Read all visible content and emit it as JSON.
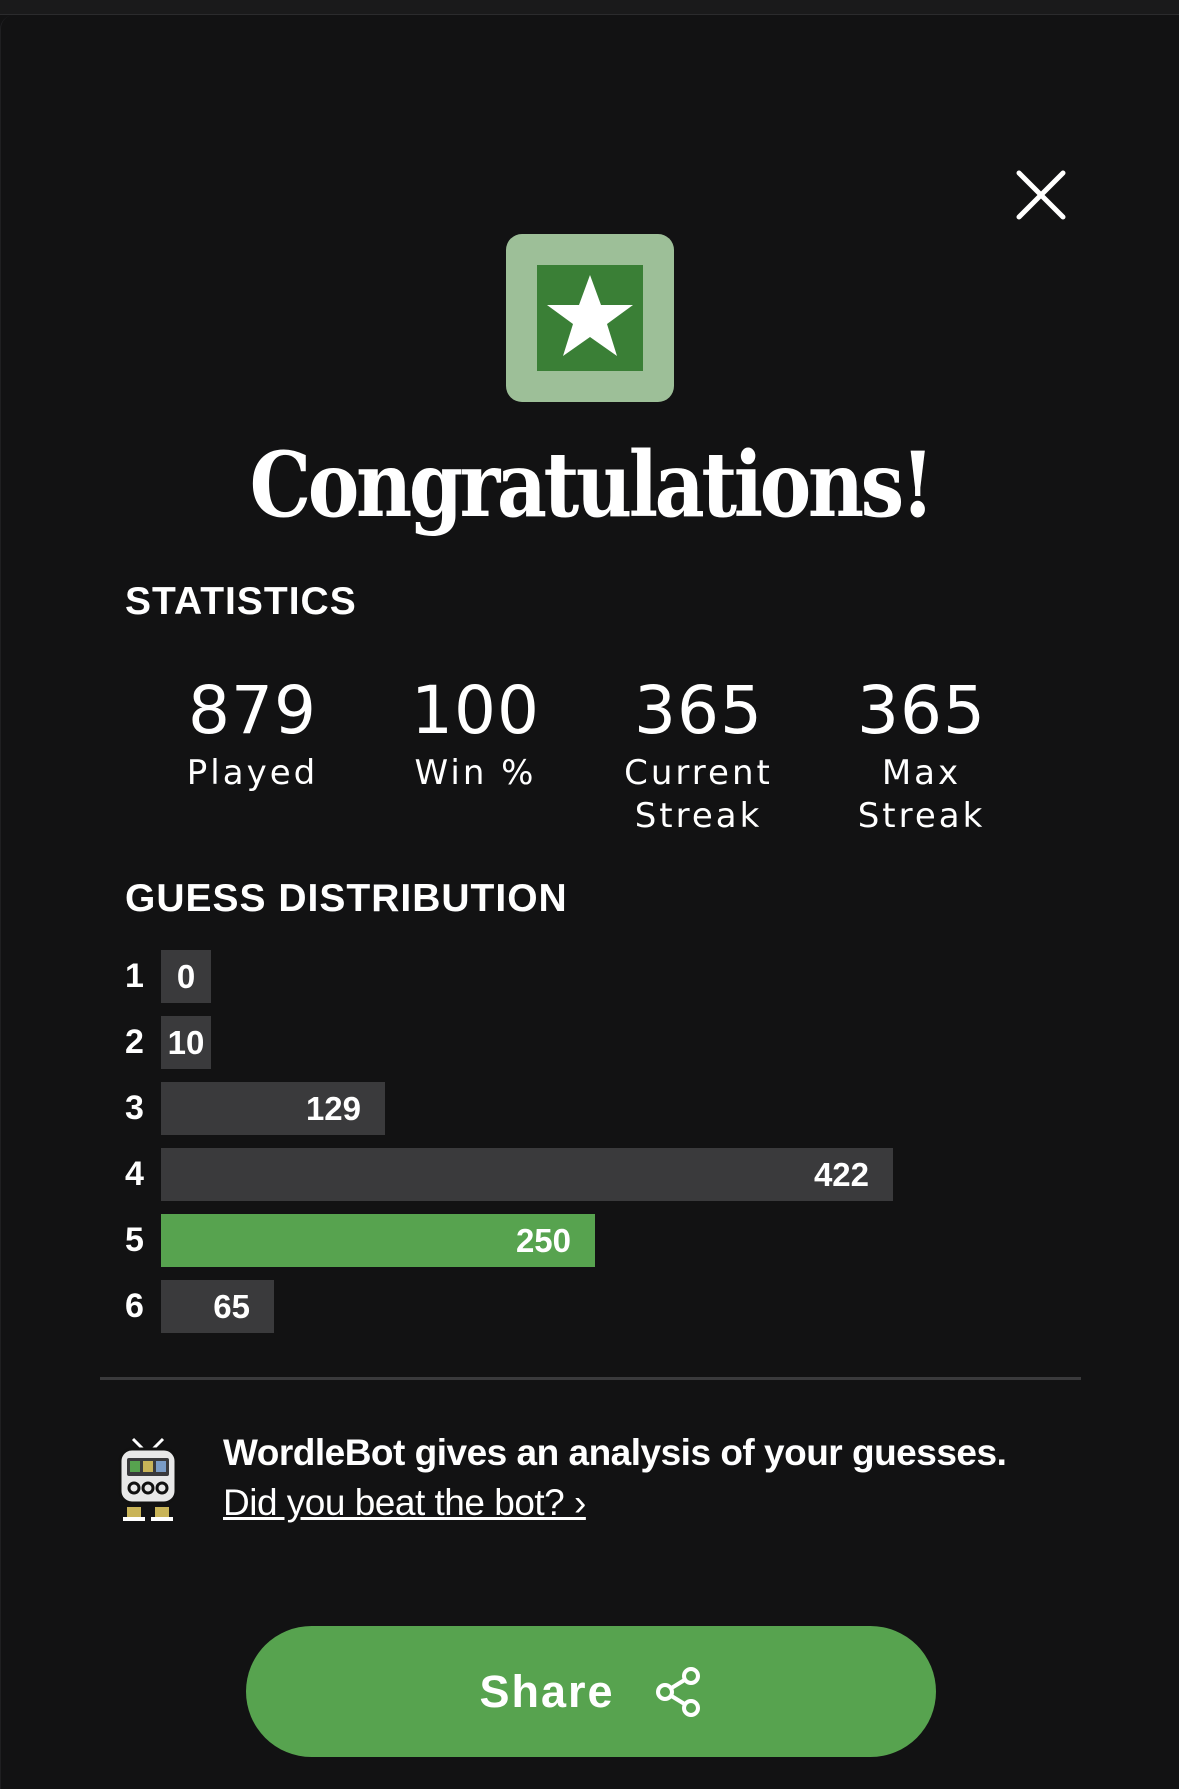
{
  "modal": {
    "title": "Congratulations!",
    "close_icon": "close-icon",
    "badge_icon": "star-icon",
    "colors": {
      "background": "#121213",
      "correct": "#57a34f",
      "bar": "#3a3a3c",
      "badge_outer": "#9dbf98",
      "badge_inner": "#3a7f36"
    }
  },
  "statistics": {
    "heading": "STATISTICS",
    "items": [
      {
        "value": "879",
        "label_lines": [
          "Played"
        ]
      },
      {
        "value": "100",
        "label_lines": [
          "Win %"
        ]
      },
      {
        "value": "365",
        "label_lines": [
          "Current",
          "Streak"
        ]
      },
      {
        "value": "365",
        "label_lines": [
          "Max",
          "Streak"
        ]
      }
    ]
  },
  "guess_distribution": {
    "heading": "GUESS DISTRIBUTION",
    "max_value": 422,
    "highlight_row": 5,
    "rows": [
      {
        "guess": "1",
        "count": 0
      },
      {
        "guess": "2",
        "count": 10
      },
      {
        "guess": "3",
        "count": 129
      },
      {
        "guess": "4",
        "count": 422
      },
      {
        "guess": "5",
        "count": 250
      },
      {
        "guess": "6",
        "count": 65
      }
    ]
  },
  "wordlebot": {
    "icon": "robot-icon",
    "text": "WordleBot gives an analysis of your guesses.",
    "link": "Did you beat the bot? ›"
  },
  "share": {
    "label": "Share",
    "icon": "share-icon"
  }
}
